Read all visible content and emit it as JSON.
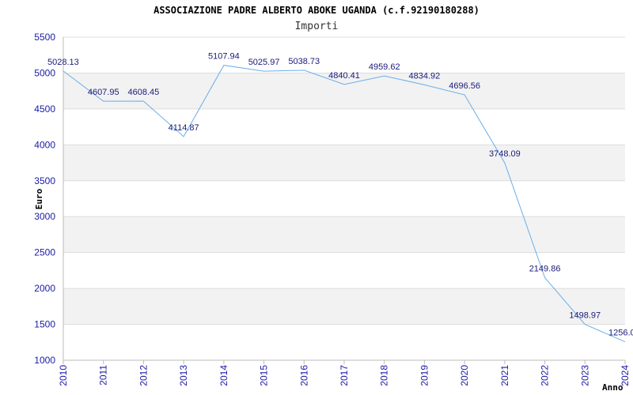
{
  "chart_data": {
    "type": "line",
    "title": "ASSOCIAZIONE PADRE ALBERTO ABOKE UGANDA (c.f.92190180288)",
    "subtitle": "Importi",
    "xlabel": "Anno",
    "ylabel": "Euro",
    "ylim": [
      1000,
      5500
    ],
    "yticks": [
      1000,
      1500,
      2000,
      2500,
      3000,
      3500,
      4000,
      4500,
      5000,
      5500
    ],
    "grid": true,
    "categories": [
      "2010",
      "2011",
      "2012",
      "2013",
      "2014",
      "2015",
      "2016",
      "2017",
      "2018",
      "2019",
      "2020",
      "2021",
      "2022",
      "2023",
      "2024"
    ],
    "series": [
      {
        "values": [
          5028.13,
          4607.95,
          4608.45,
          4114.87,
          5107.94,
          5025.97,
          5038.73,
          4840.41,
          4959.62,
          4834.92,
          4696.56,
          3748.09,
          2149.86,
          1498.97,
          1256.0
        ],
        "labels": [
          "5028.13",
          "4607.95",
          "4608.45",
          "4114.87",
          "5107.94",
          "5025.97",
          "5038.73",
          "4840.41",
          "4959.62",
          "4834.92",
          "4696.56",
          "3748.09",
          "2149.86",
          "1498.97",
          "1256.0"
        ]
      }
    ],
    "colors": {
      "line": "#6aaee8",
      "band": "#f2f2f2",
      "axis_text": "#1a1aa6",
      "label_text": "#1a1a7a",
      "grid": "#dddddd"
    }
  }
}
